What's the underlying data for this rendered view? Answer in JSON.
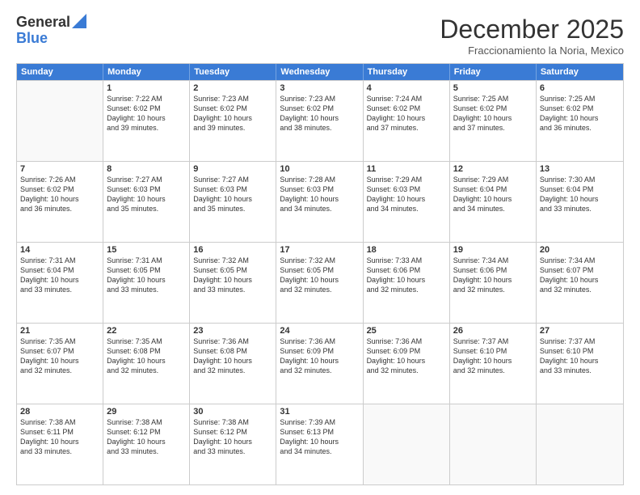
{
  "logo": {
    "general": "General",
    "blue": "Blue"
  },
  "header": {
    "month": "December 2025",
    "location": "Fraccionamiento la Noria, Mexico"
  },
  "days": [
    "Sunday",
    "Monday",
    "Tuesday",
    "Wednesday",
    "Thursday",
    "Friday",
    "Saturday"
  ],
  "weeks": [
    [
      {
        "day": "",
        "text": ""
      },
      {
        "day": "1",
        "text": "Sunrise: 7:22 AM\nSunset: 6:02 PM\nDaylight: 10 hours\nand 39 minutes."
      },
      {
        "day": "2",
        "text": "Sunrise: 7:23 AM\nSunset: 6:02 PM\nDaylight: 10 hours\nand 39 minutes."
      },
      {
        "day": "3",
        "text": "Sunrise: 7:23 AM\nSunset: 6:02 PM\nDaylight: 10 hours\nand 38 minutes."
      },
      {
        "day": "4",
        "text": "Sunrise: 7:24 AM\nSunset: 6:02 PM\nDaylight: 10 hours\nand 37 minutes."
      },
      {
        "day": "5",
        "text": "Sunrise: 7:25 AM\nSunset: 6:02 PM\nDaylight: 10 hours\nand 37 minutes."
      },
      {
        "day": "6",
        "text": "Sunrise: 7:25 AM\nSunset: 6:02 PM\nDaylight: 10 hours\nand 36 minutes."
      }
    ],
    [
      {
        "day": "7",
        "text": "Sunrise: 7:26 AM\nSunset: 6:02 PM\nDaylight: 10 hours\nand 36 minutes."
      },
      {
        "day": "8",
        "text": "Sunrise: 7:27 AM\nSunset: 6:03 PM\nDaylight: 10 hours\nand 35 minutes."
      },
      {
        "day": "9",
        "text": "Sunrise: 7:27 AM\nSunset: 6:03 PM\nDaylight: 10 hours\nand 35 minutes."
      },
      {
        "day": "10",
        "text": "Sunrise: 7:28 AM\nSunset: 6:03 PM\nDaylight: 10 hours\nand 34 minutes."
      },
      {
        "day": "11",
        "text": "Sunrise: 7:29 AM\nSunset: 6:03 PM\nDaylight: 10 hours\nand 34 minutes."
      },
      {
        "day": "12",
        "text": "Sunrise: 7:29 AM\nSunset: 6:04 PM\nDaylight: 10 hours\nand 34 minutes."
      },
      {
        "day": "13",
        "text": "Sunrise: 7:30 AM\nSunset: 6:04 PM\nDaylight: 10 hours\nand 33 minutes."
      }
    ],
    [
      {
        "day": "14",
        "text": "Sunrise: 7:31 AM\nSunset: 6:04 PM\nDaylight: 10 hours\nand 33 minutes."
      },
      {
        "day": "15",
        "text": "Sunrise: 7:31 AM\nSunset: 6:05 PM\nDaylight: 10 hours\nand 33 minutes."
      },
      {
        "day": "16",
        "text": "Sunrise: 7:32 AM\nSunset: 6:05 PM\nDaylight: 10 hours\nand 33 minutes."
      },
      {
        "day": "17",
        "text": "Sunrise: 7:32 AM\nSunset: 6:05 PM\nDaylight: 10 hours\nand 32 minutes."
      },
      {
        "day": "18",
        "text": "Sunrise: 7:33 AM\nSunset: 6:06 PM\nDaylight: 10 hours\nand 32 minutes."
      },
      {
        "day": "19",
        "text": "Sunrise: 7:34 AM\nSunset: 6:06 PM\nDaylight: 10 hours\nand 32 minutes."
      },
      {
        "day": "20",
        "text": "Sunrise: 7:34 AM\nSunset: 6:07 PM\nDaylight: 10 hours\nand 32 minutes."
      }
    ],
    [
      {
        "day": "21",
        "text": "Sunrise: 7:35 AM\nSunset: 6:07 PM\nDaylight: 10 hours\nand 32 minutes."
      },
      {
        "day": "22",
        "text": "Sunrise: 7:35 AM\nSunset: 6:08 PM\nDaylight: 10 hours\nand 32 minutes."
      },
      {
        "day": "23",
        "text": "Sunrise: 7:36 AM\nSunset: 6:08 PM\nDaylight: 10 hours\nand 32 minutes."
      },
      {
        "day": "24",
        "text": "Sunrise: 7:36 AM\nSunset: 6:09 PM\nDaylight: 10 hours\nand 32 minutes."
      },
      {
        "day": "25",
        "text": "Sunrise: 7:36 AM\nSunset: 6:09 PM\nDaylight: 10 hours\nand 32 minutes."
      },
      {
        "day": "26",
        "text": "Sunrise: 7:37 AM\nSunset: 6:10 PM\nDaylight: 10 hours\nand 32 minutes."
      },
      {
        "day": "27",
        "text": "Sunrise: 7:37 AM\nSunset: 6:10 PM\nDaylight: 10 hours\nand 33 minutes."
      }
    ],
    [
      {
        "day": "28",
        "text": "Sunrise: 7:38 AM\nSunset: 6:11 PM\nDaylight: 10 hours\nand 33 minutes."
      },
      {
        "day": "29",
        "text": "Sunrise: 7:38 AM\nSunset: 6:12 PM\nDaylight: 10 hours\nand 33 minutes."
      },
      {
        "day": "30",
        "text": "Sunrise: 7:38 AM\nSunset: 6:12 PM\nDaylight: 10 hours\nand 33 minutes."
      },
      {
        "day": "31",
        "text": "Sunrise: 7:39 AM\nSunset: 6:13 PM\nDaylight: 10 hours\nand 34 minutes."
      },
      {
        "day": "",
        "text": ""
      },
      {
        "day": "",
        "text": ""
      },
      {
        "day": "",
        "text": ""
      }
    ]
  ]
}
